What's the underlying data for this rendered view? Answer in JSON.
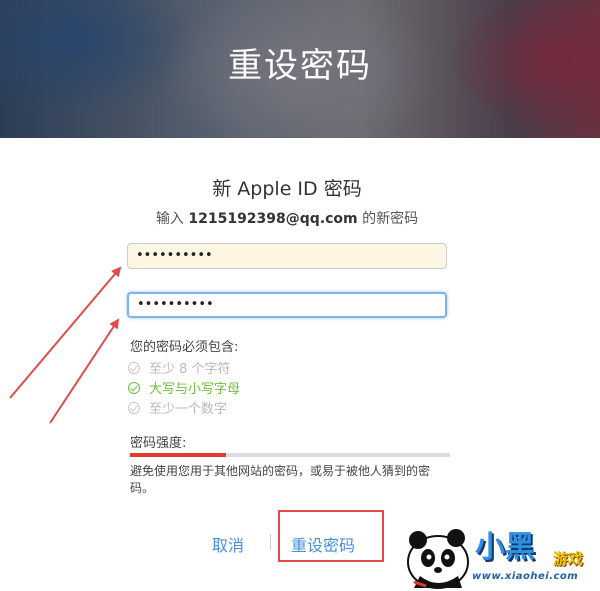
{
  "banner": {
    "title": "重设密码"
  },
  "form": {
    "subtitle": "新 Apple ID 密码",
    "instruction_prefix": "输入 ",
    "email": "1215192398@qq.com",
    "instruction_suffix": " 的新密码",
    "new_password_value": "••••••••••",
    "confirm_password_value": "••••••••••"
  },
  "requirements": {
    "title": "您的密码必须包含:",
    "items": [
      {
        "label": "至少 8 个字符",
        "met": false
      },
      {
        "label": "大写与小写字母",
        "met": true
      },
      {
        "label": "至少一个数字",
        "met": false
      }
    ]
  },
  "strength": {
    "label": "密码强度:",
    "level_fraction": 0.3,
    "bar_color": "#e33b2e",
    "description": "避免使用您用于其他网站的密码，或易于被他人猜到的密码。"
  },
  "actions": {
    "cancel_label": "取消",
    "reset_label": "重设密码"
  },
  "watermark": {
    "brand": "小黑",
    "tag": "游戏",
    "url": "www.xiaohei.com"
  },
  "colors": {
    "link": "#4a90d9",
    "annotation": "#e14b4b",
    "requirement_met": "#6fbf3f"
  }
}
